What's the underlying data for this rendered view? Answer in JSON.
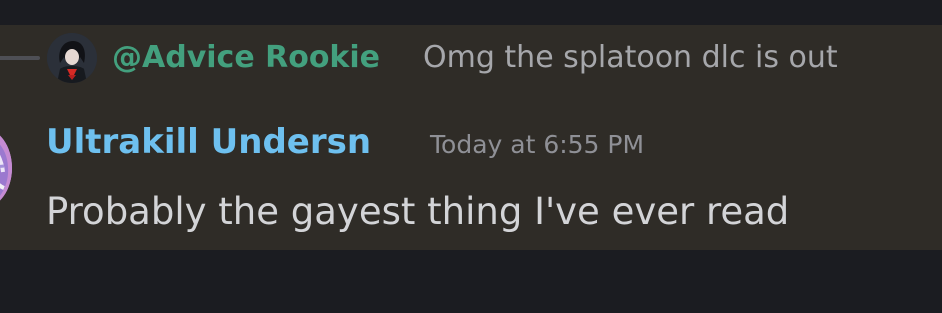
{
  "reply": {
    "author": "@Advice Rookie",
    "text": "Omg the splatoon dlc is out",
    "avatar_icon": "reply-author-avatar"
  },
  "message": {
    "author": "Ultrakill Undersn",
    "timestamp": "Today at 6:55 PM",
    "body": "Probably the gayest thing I've ever read",
    "avatar_icon": "author-avatar"
  },
  "colors": {
    "background": "#1b1c21",
    "message_highlight": "#2f2c27",
    "reply_author": "#43a07e",
    "author_name": "#6ec0ef",
    "text_muted": "#a6a7ab",
    "text_main": "#d3d4d7"
  }
}
